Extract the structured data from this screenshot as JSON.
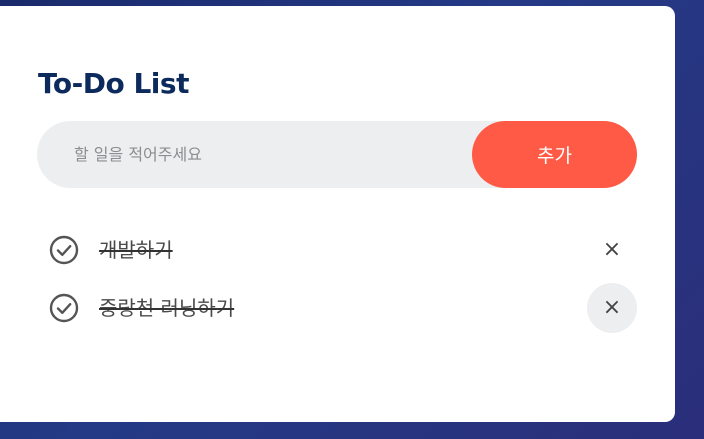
{
  "app": {
    "title": "To-Do List"
  },
  "input": {
    "placeholder": "할 일을 적어주세요",
    "value": ""
  },
  "add_button": {
    "label": "추가",
    "color": "#ff5a45"
  },
  "todos": [
    {
      "text": "개발하기",
      "completed": true,
      "check_icon": "check-circle-icon",
      "delete_label": "×",
      "hovered": false
    },
    {
      "text": "중랑천 러닝하기",
      "completed": true,
      "check_icon": "check-circle-icon",
      "delete_label": "×",
      "hovered": true
    }
  ],
  "colors": {
    "title": "#0d2a5c",
    "input_bg": "#eceef0",
    "accent": "#ff5a45",
    "background": "#1a2a6c"
  }
}
